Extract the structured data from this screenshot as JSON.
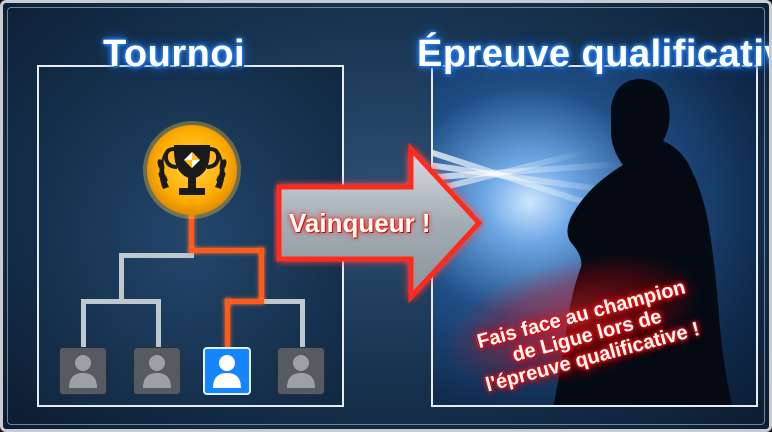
{
  "left": {
    "title": "Tournoi"
  },
  "right": {
    "title": "Épreuve qualificative"
  },
  "arrow": {
    "label": "Vainqueur !"
  },
  "message": {
    "line1": "Fais face au champion",
    "line2": "de Ligue lors de",
    "line3": "l'épreuve qualificative !"
  },
  "bracket": {
    "players": [
      "opponent",
      "opponent",
      "player",
      "opponent"
    ],
    "active_player_index": 2
  },
  "icons": [
    "trophy-icon",
    "laurel-icon",
    "person-icon"
  ],
  "colors": {
    "highlight_path": "#ff5a1a",
    "active_player": "#1686ff",
    "title_glow": "#2f8cff",
    "message_glow": "#ff1a1a",
    "trophy_badge": "#ffb300"
  }
}
